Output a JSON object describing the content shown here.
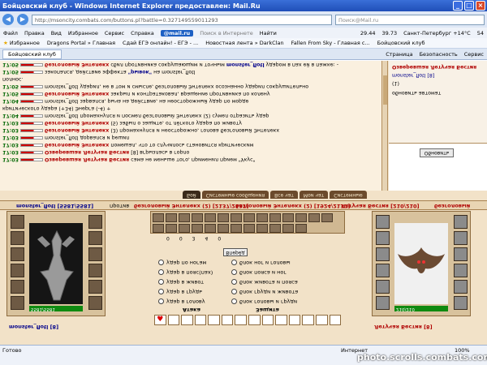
{
  "window": {
    "title": "Бойцовский клуб - Windows Internet Explorer предоставлен: Mail.Ru",
    "url": "http://msoncity.combats.com/buttons.pl?battle=0.327149559011293",
    "search_placeholder": "Поиск@Mail.ru"
  },
  "menubar": {
    "items": [
      "Файл",
      "Правка",
      "Вид",
      "Избранное",
      "Сервис",
      "Справка"
    ],
    "mailru": "@mail.ru",
    "search_hint": "Поиск в Интернете",
    "find": "Найти",
    "stocks": [
      "29.44",
      "39.73"
    ],
    "weather": "Санкт-Петербург +14°C",
    "count": "54"
  },
  "favorites": {
    "label": "Избранное",
    "items": [
      "Dragons Portal » Главная",
      "Сдай ЕГЭ онлайн! - ЕГЭ - ...",
      "Новостная лента » DarkClan",
      "Fallen From Sky - Главная с...",
      "Бойцовский клуб"
    ]
  },
  "tabbar": {
    "tab": "Бойцовский клуб",
    "commands": [
      "Страница",
      "Безопасность",
      "Сервис"
    ]
  },
  "log": {
    "lines": [
      {
        "time": "17:05",
        "text": "безголовый Энтелекх",
        "rest": " сбил противника сокрушающим и точным ",
        "who": "monster_flotl",
        "end": " ударом в пах ей в пажке: -"
      },
      {
        "time": "17:05",
        "text": "",
        "rest": "закопался, действие эффекта ",
        "who": "\"рывок\"",
        "end": " на monster_flotl"
      },
      {
        "time": "",
        "text": "",
        "rest": "полнос.",
        "who": "",
        "end": ""
      },
      {
        "time": "17:05",
        "text": "",
        "rest": "monster_flotl ",
        "who": "",
        "end": "ударил, не в том и смысле, безголовый Энтелекх осознанно ударил сокрушительно"
      },
      {
        "time": "17:05",
        "text": "безголовый Энтелекх",
        "rest": " закрыл и контратаковал, вращение противника по колену",
        "who": "",
        "end": ""
      },
      {
        "time": "17:04",
        "text": "",
        "rest": "monster_flotl ",
        "who": "",
        "end": "зарвался, рыча на действие, на неосторожный удар по морде"
      },
      {
        "time": "",
        "text": "",
        "rest": "критического удара (+34) ",
        "who": "",
        "end": "Энерга (-4) +"
      },
      {
        "time": "17:04",
        "text": "",
        "rest": "monster_flotl ",
        "who": "",
        "end": "промахнулся и посмел безголовый Энтелекх (2) сумел отразить удар"
      },
      {
        "time": "17:03",
        "text": "безголовый Энтелекх",
        "rest": " (5) забыл о защите, от лёгкого удара по животу",
        "who": "",
        "end": ""
      },
      {
        "time": "17:03",
        "text": "безголовый Энтелекх",
        "rest": " (3) промахнулся и неосторожно, голова безголовый Энтелекх",
        "who": "",
        "end": ""
      },
      {
        "time": "17:03",
        "text": "",
        "rest": "monster_flotl ",
        "who": "",
        "end": "дорвался и решил"
      },
      {
        "time": "17:03",
        "text": "безголовый Энтелекх",
        "rest": " помешал, что то случилось становится критическим",
        "who": "",
        "end": ""
      },
      {
        "time": "17:03",
        "text": "Озверевшая Летучая Бестия",
        "rest": " [8] ",
        "who": "",
        "end": "вгрызлась в горло"
      },
      {
        "time": "17:03",
        "text": "Озверевшая Летучая Бестия",
        "rest": " сама не меньше того, применил прием \"Укус\"",
        "who": "",
        "end": ""
      }
    ]
  },
  "rightpane": {
    "update": "Обновить",
    "lines": [
      "Озверевшая Летучая Бестия",
      "monster_flotl [8]",
      "(1)",
      "обновить автомат"
    ]
  },
  "logtabs": [
    "Бой",
    "Системные сообщения",
    "Все чат",
    "Мои чат",
    "Системные"
  ],
  "battlebar": {
    "left": "monster_flotl [5581/5581]",
    "vs": "против",
    "mid": "безголовый Энтелекх (2) [2137/2137]",
    "mid2": "безголовый Энтелекх (2) [1924/2137]",
    "right": "Летучая Бестия [210/210]",
    "right2": "безголовый"
  },
  "players": {
    "left_name": "monster_flotl [8]",
    "left_hp": "5581/5581",
    "right_name": "Летучая Бестия [8]",
    "right_hp": "210/210"
  },
  "center": {
    "counters": [
      "0",
      "0",
      "3",
      "4",
      "0"
    ],
    "go": "Вперёд",
    "attack_label": "Атака",
    "defend_label": "Защита",
    "attack_zones": [
      "удар в голову",
      "удар в грудь",
      "удар в живот",
      "удар в пояс(пах)",
      "удар по ногам"
    ],
    "defend_zones": [
      "блок головы и груди",
      "блок груди и живота",
      "блок живота и пояса",
      "блок пояса и ног",
      "блок ног и головы"
    ]
  },
  "status": {
    "left": "Готово",
    "zone": "Интернет",
    "zoom": "100%",
    "watermark": "photo.scrolls.combats.com"
  }
}
